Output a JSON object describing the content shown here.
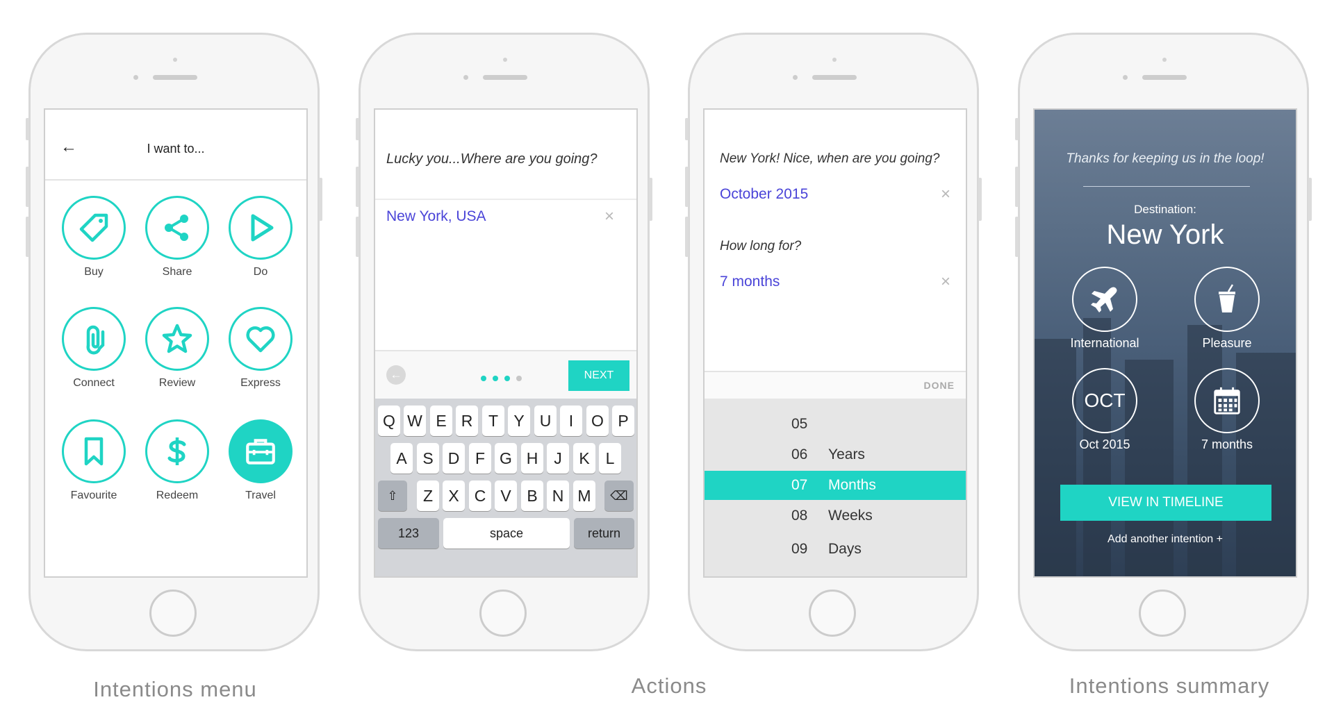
{
  "accent_color": "#1fd4c4",
  "value_color": "#4a44d8",
  "captions": {
    "menu": "Intentions menu",
    "actions": "Actions",
    "summary": "Intentions summary"
  },
  "screen1": {
    "title": "I want to...",
    "back_icon": "arrow-left-icon",
    "items": [
      {
        "label": "Buy",
        "icon": "tag-icon"
      },
      {
        "label": "Share",
        "icon": "share-icon"
      },
      {
        "label": "Do",
        "icon": "play-icon"
      },
      {
        "label": "Connect",
        "icon": "link-icon"
      },
      {
        "label": "Review",
        "icon": "star-icon"
      },
      {
        "label": "Express",
        "icon": "heart-icon"
      },
      {
        "label": "Favourite",
        "icon": "bookmark-icon"
      },
      {
        "label": "Redeem",
        "icon": "dollar-icon"
      },
      {
        "label": "Travel",
        "icon": "suitcase-icon",
        "selected": true
      }
    ]
  },
  "screen2": {
    "question": "Lucky you...Where are you going?",
    "value": "New York, USA",
    "next_label": "NEXT",
    "step_current": 3,
    "step_total": 4,
    "keyboard": {
      "row1": [
        "Q",
        "W",
        "E",
        "R",
        "T",
        "Y",
        "U",
        "I",
        "O",
        "P"
      ],
      "row2": [
        "A",
        "S",
        "D",
        "F",
        "G",
        "H",
        "J",
        "K",
        "L"
      ],
      "row3": [
        "Z",
        "X",
        "C",
        "V",
        "B",
        "N",
        "M"
      ],
      "numbers_label": "123",
      "space_label": "space",
      "return_label": "return"
    }
  },
  "screen3": {
    "question1": "New York! Nice, when are you going?",
    "value1": "October 2015",
    "question2": "How long for?",
    "value2": "7 months",
    "done_label": "DONE",
    "picker": [
      {
        "num": "05",
        "unit": ""
      },
      {
        "num": "06",
        "unit": "Years"
      },
      {
        "num": "07",
        "unit": "Months",
        "selected": true
      },
      {
        "num": "08",
        "unit": "Weeks"
      },
      {
        "num": "09",
        "unit": "Days"
      }
    ]
  },
  "screen4": {
    "thanks": "Thanks for keeping us in the loop!",
    "destination_label": "Destination:",
    "destination": "New York",
    "items": [
      {
        "label": "International",
        "icon": "airplane-icon"
      },
      {
        "label": "Pleasure",
        "icon": "drink-icon"
      },
      {
        "label": "Oct 2015",
        "icon_text": "OCT"
      },
      {
        "label": "7 months",
        "icon": "calendar-icon"
      }
    ],
    "button_label": "VIEW IN TIMELINE",
    "add_label": "Add another intention +"
  }
}
